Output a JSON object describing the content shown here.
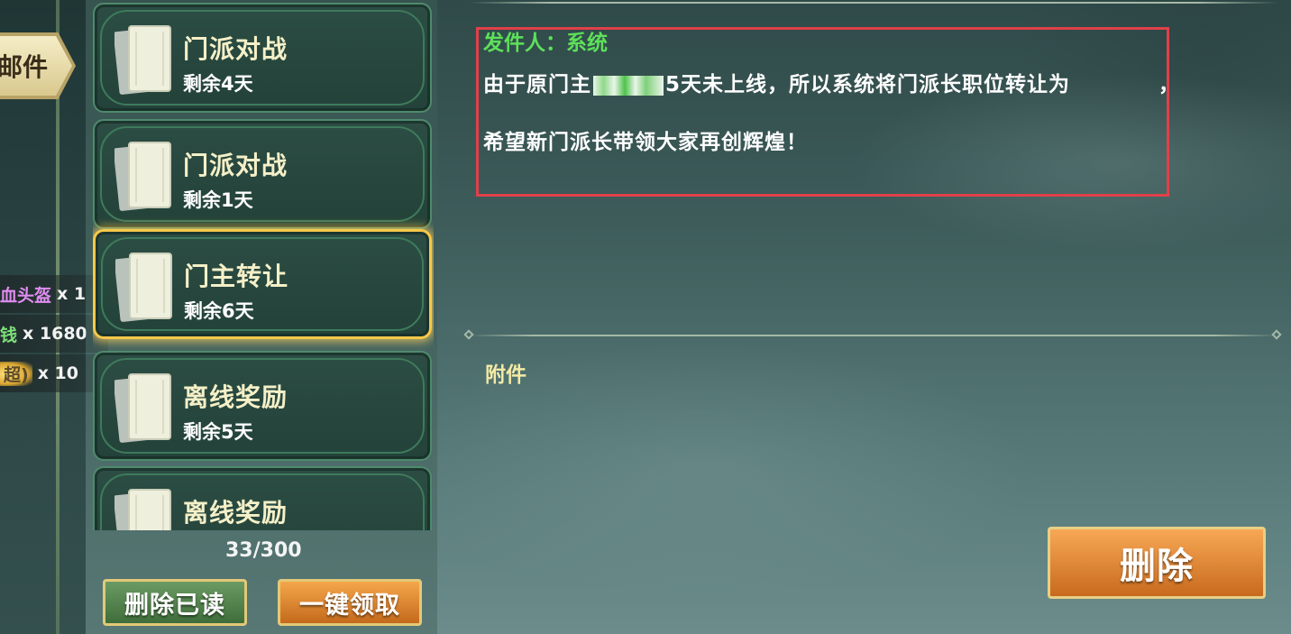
{
  "sidebar": {
    "category_tab_label": "邮件",
    "rewards": [
      {
        "name": "血头盔",
        "count": "x 1",
        "color": "#e08cf0"
      },
      {
        "name": "钱",
        "count": "x 1680",
        "color": "#7fe07a"
      },
      {
        "name": "超)",
        "count": "x 10",
        "color": "#d9a531"
      }
    ]
  },
  "mail_list": {
    "items": [
      {
        "title": "门派对战",
        "remaining": "剩余4天",
        "selected": false
      },
      {
        "title": "门派对战",
        "remaining": "剩余1天",
        "selected": false
      },
      {
        "title": "门主转让",
        "remaining": "剩余6天",
        "selected": true
      },
      {
        "title": "离线奖励",
        "remaining": "剩余5天",
        "selected": false
      },
      {
        "title": "离线奖励",
        "remaining": "",
        "selected": false
      }
    ],
    "count": "33/300",
    "delete_read_label": "删除已读",
    "claim_all_label": "一键领取"
  },
  "detail": {
    "sender_label": "发件人：",
    "sender_value": "系统",
    "body_line1_prefix": "由于原门主",
    "body_line1_suffix": "5天未上线，所以系统将门派长职位转让为",
    "body_line1_comma": "，",
    "body_line2": "希望新门派长带领大家再创辉煌！",
    "attachment_label": "附件",
    "delete_label": "删除"
  },
  "colors": {
    "highlight_border": "#e0404a",
    "sender_green": "#5de05a",
    "selected_gold": "#f6c84a"
  }
}
